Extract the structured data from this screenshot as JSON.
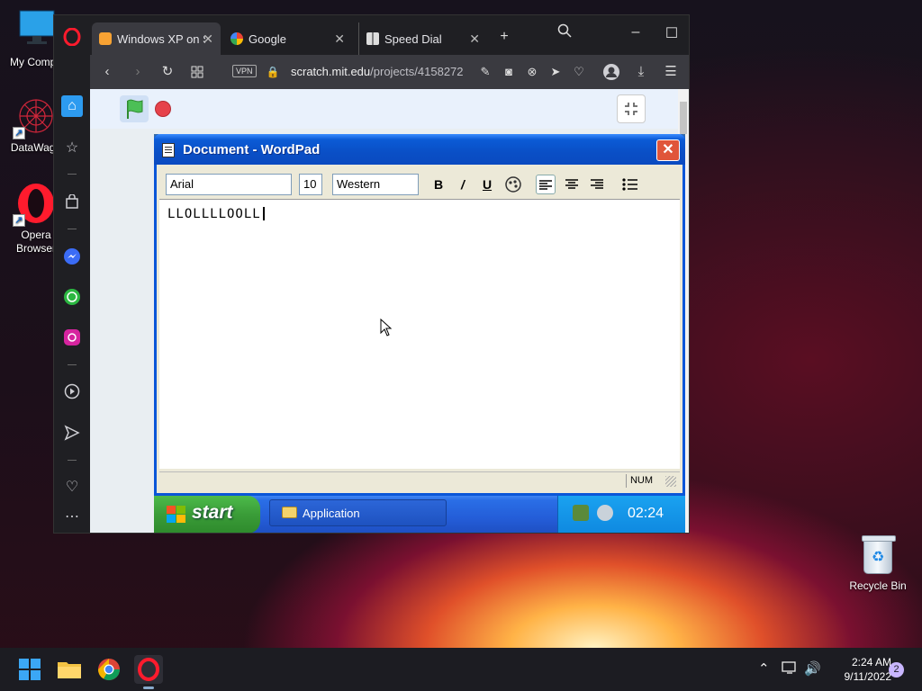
{
  "desktop": {
    "icons": [
      {
        "label": "My Compu",
        "icon": "monitor-icon"
      },
      {
        "label": "DataWago",
        "icon": "datawagon-icon"
      },
      {
        "label": "Opera Browser",
        "icon": "opera-icon"
      }
    ],
    "recycle_bin": {
      "label": "Recycle Bin",
      "icon": "recycle-bin-icon"
    }
  },
  "browser": {
    "tabs": [
      {
        "label": "Windows XP on S",
        "icon": "scratch-favicon"
      },
      {
        "label": "Google",
        "icon": "google-favicon"
      },
      {
        "label": "Speed Dial",
        "icon": "speed-dial-icon"
      }
    ],
    "new_tab": "+",
    "vpn_badge": "VPN",
    "url_domain": "scratch.mit.edu",
    "url_path": "/projects/4158272",
    "sidebar_icons": [
      "home-icon",
      "star-icon",
      "bag-icon",
      "messenger-icon",
      "whatsapp-icon",
      "instagram-icon",
      "player-icon",
      "send-icon",
      "heart-icon",
      "more-icon"
    ]
  },
  "wordpad": {
    "title": "Document - WordPad",
    "font": "Arial",
    "size": "10",
    "script": "Western",
    "bold": "B",
    "italic": "/",
    "underline": "U",
    "text": "LLOLLLLOOLL",
    "status_num": "NUM"
  },
  "xp_taskbar": {
    "start": "start",
    "task_label": "Application",
    "clock": "02:24"
  },
  "win_taskbar": {
    "time": "2:24 AM",
    "date": "9/11/2022",
    "notifications": "2"
  },
  "colors": {
    "xp_title_blue": "#0a4fc6",
    "xp_start_green": "#3a9c38",
    "opera_red": "#ff1b2d",
    "scratch_flag_green": "#4cbf56",
    "scratch_stop_red": "#e6424b"
  }
}
